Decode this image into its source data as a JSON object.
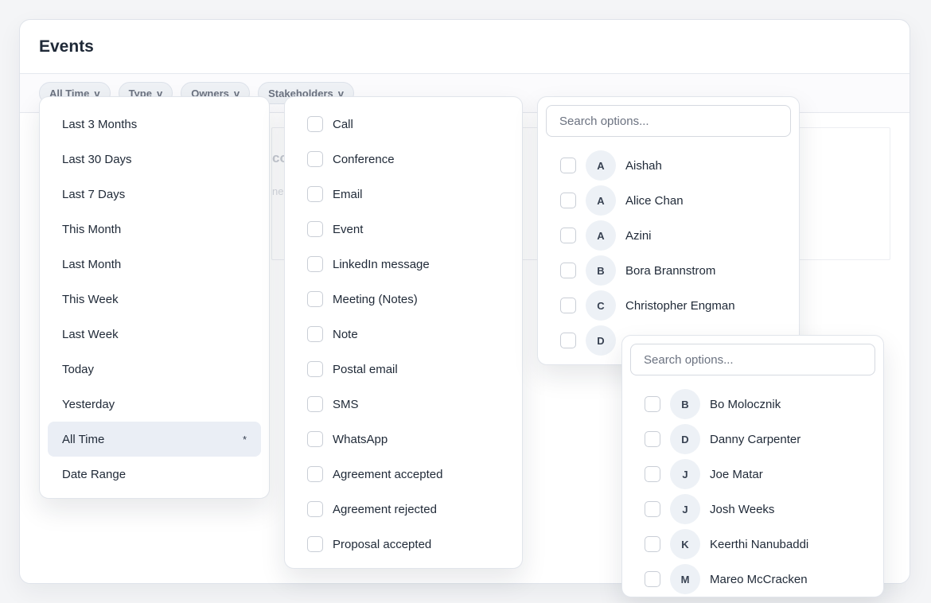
{
  "page": {
    "title": "Events"
  },
  "filters": [
    {
      "label": "All Time",
      "chevron": "v"
    },
    {
      "label": "Type",
      "chevron": "v"
    },
    {
      "label": "Owners",
      "chevron": "v"
    },
    {
      "label": "Stakeholders",
      "chevron": "v"
    }
  ],
  "background": {
    "text1": "co",
    "text2": "nec"
  },
  "time_dropdown": {
    "options": [
      "Last 3 Months",
      "Last 30 Days",
      "Last 7 Days",
      "This Month",
      "Last Month",
      "This Week",
      "Last Week",
      "Today",
      "Yesterday",
      "All Time",
      "Date Range"
    ],
    "selected": "All Time",
    "selected_mark": "*"
  },
  "type_dropdown": {
    "options": [
      "Call",
      "Conference",
      "Email",
      "Event",
      "LinkedIn message",
      "Meeting (Notes)",
      "Note",
      "Postal email",
      "SMS",
      "WhatsApp",
      "Agreement accepted",
      "Agreement rejected",
      "Proposal accepted"
    ]
  },
  "owners_dropdown": {
    "search_placeholder": "Search options...",
    "people": [
      {
        "initial": "A",
        "name": "Aishah"
      },
      {
        "initial": "A",
        "name": "Alice Chan"
      },
      {
        "initial": "A",
        "name": "Azini"
      },
      {
        "initial": "B",
        "name": "Bora Brannstrom"
      },
      {
        "initial": "C",
        "name": "Christopher Engman"
      },
      {
        "initial": "D",
        "name": ""
      }
    ]
  },
  "stakeholders_dropdown": {
    "search_placeholder": "Search options...",
    "people": [
      {
        "initial": "B",
        "name": "Bo Molocznik"
      },
      {
        "initial": "D",
        "name": "Danny Carpenter"
      },
      {
        "initial": "J",
        "name": "Joe Matar"
      },
      {
        "initial": "J",
        "name": "Josh Weeks"
      },
      {
        "initial": "K",
        "name": "Keerthi Nanubaddi"
      },
      {
        "initial": "M",
        "name": "Mareo McCracken"
      }
    ]
  }
}
